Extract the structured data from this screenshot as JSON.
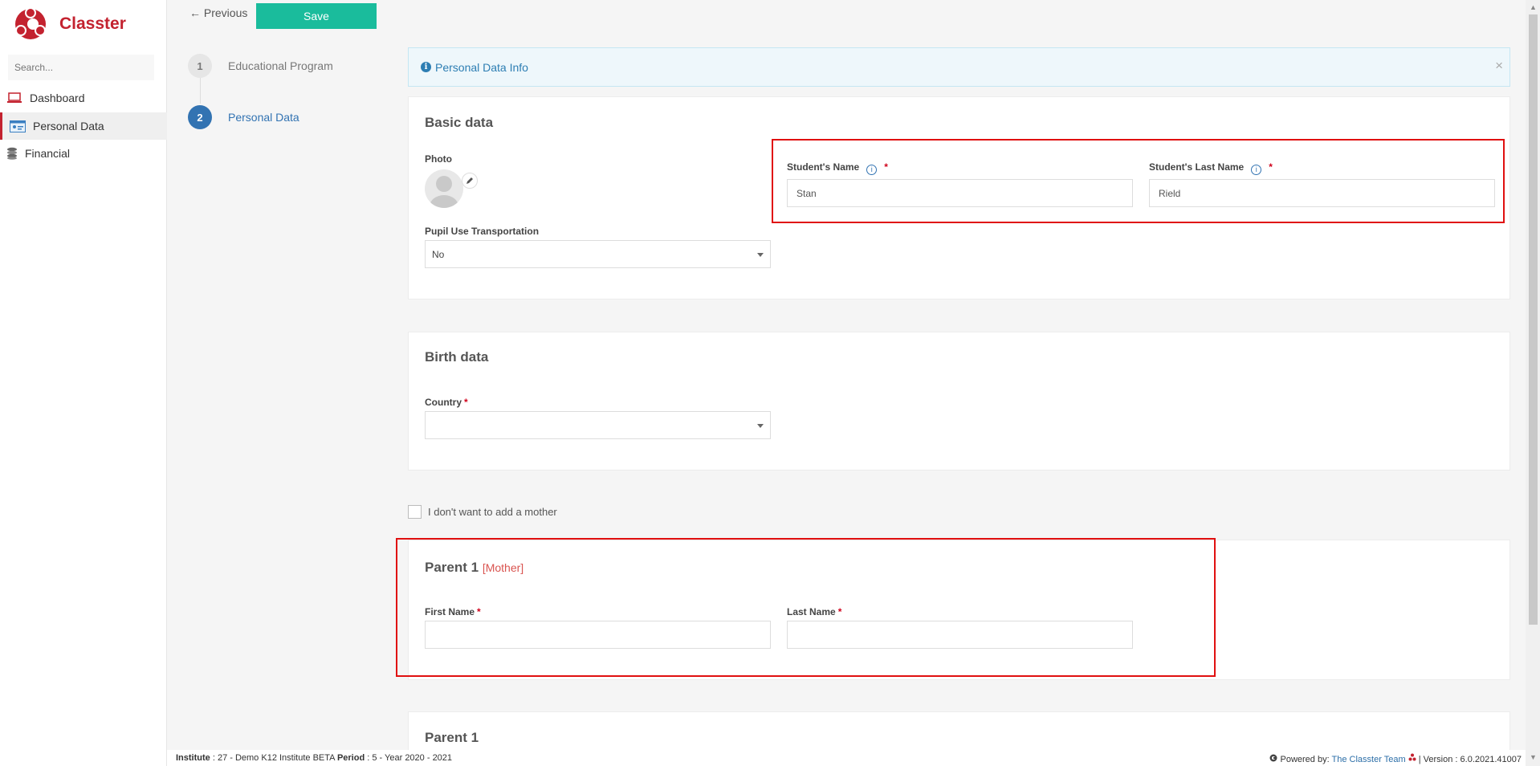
{
  "app": {
    "brand": "Classter",
    "brand_color": "#c3222f"
  },
  "sidebar": {
    "search_placeholder": "Search...",
    "items": [
      {
        "label": "Dashboard",
        "icon": "laptop-icon"
      },
      {
        "label": "Personal Data",
        "icon": "id-card-icon",
        "active": true
      },
      {
        "label": "Financial",
        "icon": "coins-icon"
      }
    ]
  },
  "toolbar": {
    "previous_label": "← Previous",
    "save_label": "Save"
  },
  "stepper": [
    {
      "number": "1",
      "label": "Educational Program"
    },
    {
      "number": "2",
      "label": "Personal Data"
    }
  ],
  "banner": {
    "text": "Personal Data Info",
    "close": "×"
  },
  "basic": {
    "title": "Basic data",
    "photo_label": "Photo",
    "student_name_label": "Student's Name",
    "student_name_value": "Stan",
    "student_last_label": "Student's Last Name",
    "student_last_value": "Rield",
    "transport_label": "Pupil Use Transportation",
    "transport_value": "No"
  },
  "birth": {
    "title": "Birth data",
    "country_label": "Country",
    "country_value": ""
  },
  "mother_checkbox_label": "I don't want to add a mother",
  "parent1": {
    "title": "Parent 1",
    "role": "[Mother]",
    "first_name_label": "First Name",
    "last_name_label": "Last Name"
  },
  "parent2": {
    "title": "Parent 1"
  },
  "required_mark": "*",
  "info_mark": "i",
  "footer": {
    "institute_label": "Institute",
    "institute_value": " : 27 - Demo K12 Institute BETA ",
    "period_label": "Period",
    "period_value": " : 5 - Year 2020 - 2021",
    "powered_prefix": "Powered by: ",
    "powered_link": "The Classter Team",
    "version": " | Version : 6.0.2021.41007"
  },
  "colors": {
    "accent": "#1abc9c",
    "primary": "#3273b2",
    "highlight": "#e01010"
  }
}
